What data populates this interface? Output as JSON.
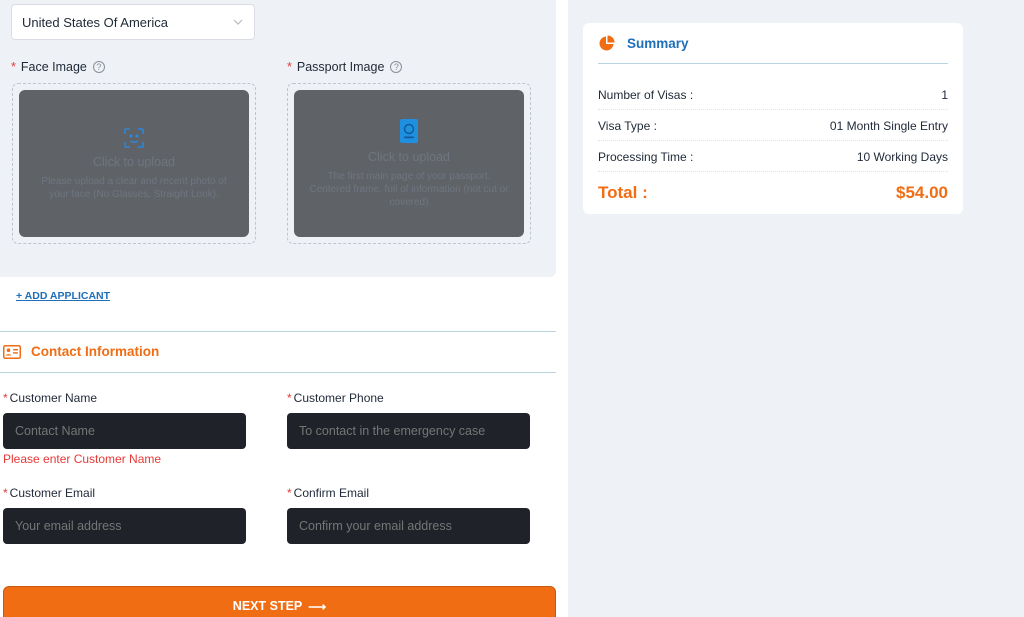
{
  "applicant": {
    "nationality": "United States Of America",
    "face_image": {
      "label": "Face Image",
      "upload_title": "Click to upload",
      "upload_hint": "Please upload a clear and recent photo of your face (No Glasses, Straight Look)."
    },
    "passport_image": {
      "label": "Passport Image",
      "upload_title": "Click to upload",
      "upload_hint": "The first main page of your passport. Centered frame, full of information (not cut or covered)"
    },
    "add_applicant": "+ ADD APPLICANT"
  },
  "contact": {
    "title": "Contact Information",
    "customer_name": {
      "label": "Customer Name",
      "placeholder": "Contact Name",
      "error": "Please enter Customer Name"
    },
    "customer_phone": {
      "label": "Customer Phone",
      "placeholder": "To contact in the emergency case"
    },
    "customer_email": {
      "label": "Customer Email",
      "placeholder": "Your email address"
    },
    "confirm_email": {
      "label": "Confirm Email",
      "placeholder": "Confirm your email address"
    }
  },
  "next_button": {
    "label": "NEXT STEP",
    "arrow": "⟶"
  },
  "summary": {
    "title": "Summary",
    "rows": [
      {
        "label": "Number of Visas :",
        "value": "1"
      },
      {
        "label": "Visa Type :",
        "value": "01 Month Single Entry"
      },
      {
        "label": "Processing Time :",
        "value": "10 Working Days"
      }
    ],
    "total_label": "Total :",
    "total_value": "$54.00"
  },
  "colors": {
    "accent_orange": "#f06d14",
    "accent_blue": "#1e6fb8",
    "error_red": "#e53935",
    "input_bg": "#1f2329",
    "panel_bg": "#eef1f6"
  },
  "icons": {
    "face_scan": "face-scan-icon",
    "passport": "passport-icon",
    "contact_card": "contact-card-icon",
    "summary_pie": "pie-chart-icon",
    "help": "question-circle-icon",
    "chevron": "chevron-down-icon"
  }
}
